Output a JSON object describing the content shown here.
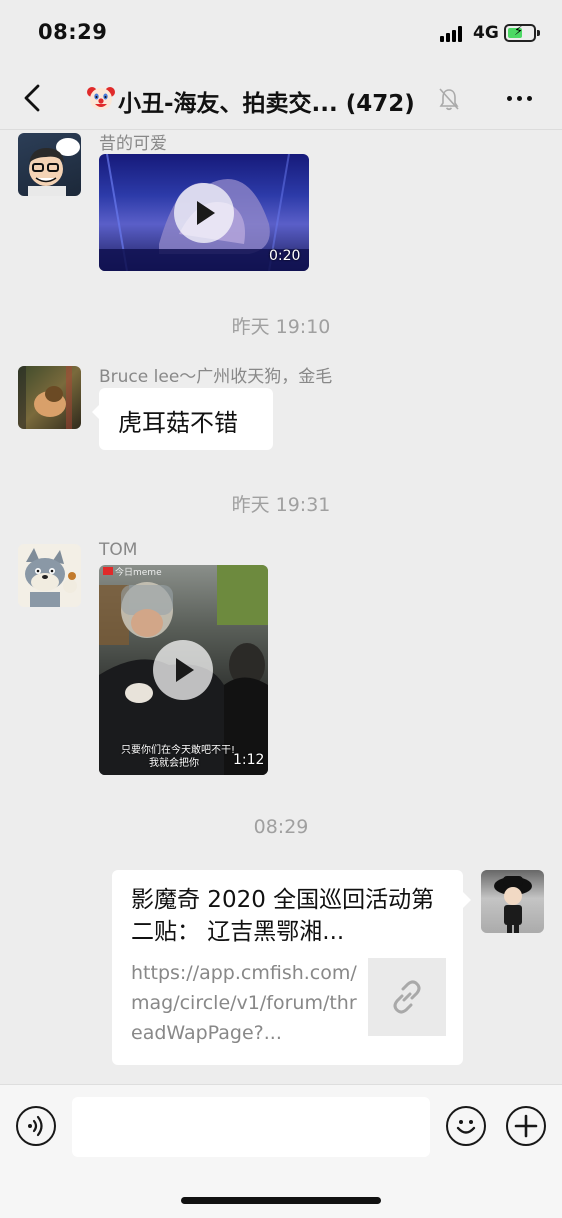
{
  "status_bar": {
    "time": "08:29",
    "network": "4G",
    "battery_level": 0.6
  },
  "nav": {
    "title": "小丑-海友、拍卖交... (472)",
    "title_emoji_icon": "clown-face-icon",
    "muted": true
  },
  "messages": [
    {
      "type": "video",
      "sender": "昔的可爱",
      "duration": "0:20"
    },
    {
      "type": "timestamp",
      "text": "昨天 19:10"
    },
    {
      "type": "text",
      "sender": "Bruce lee～广州收天狗，金毛",
      "text": "虎耳菇不错"
    },
    {
      "type": "timestamp",
      "text": "昨天 19:31"
    },
    {
      "type": "video",
      "sender": "TOM",
      "duration": "1:12",
      "watermark": "今日meme",
      "subtitle_line1": "只要你们在今天敢吧不干!",
      "subtitle_line2": "我就会把你"
    },
    {
      "type": "timestamp",
      "text": "08:29"
    },
    {
      "type": "link",
      "title": "影魔奇 2020 全国巡回活动第二贴： 辽吉黑鄂湘...",
      "url": "https://app.cmfish.com/mag/circle/v1/forum/threadWapPage?..."
    }
  ],
  "input_bar": {
    "input_value": "",
    "voice_icon": "voice-icon",
    "emoji_icon": "emoji-smile-icon",
    "plus_icon": "plus-icon"
  },
  "colors": {
    "background": "#ededed",
    "bubble": "#ffffff",
    "timestamp": "#a0a0a0",
    "battery_fill": "#4cd964"
  }
}
